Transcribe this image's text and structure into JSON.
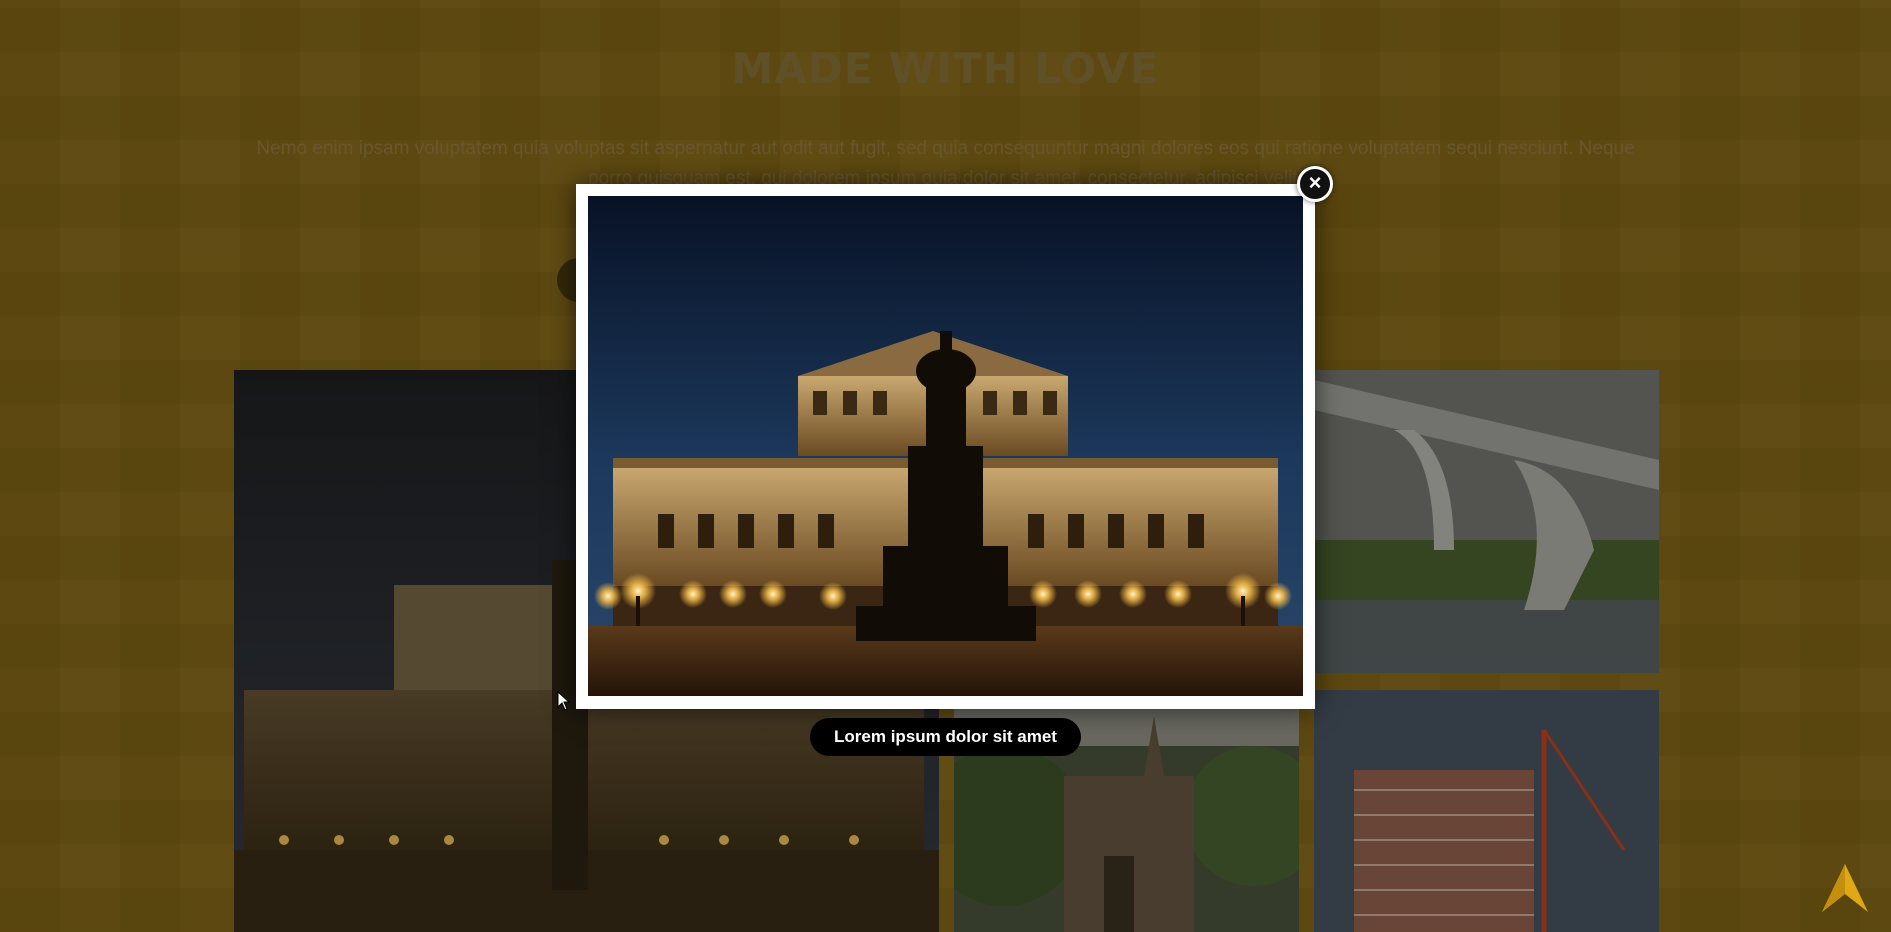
{
  "section": {
    "title": "MADE WITH LOVE",
    "text": "Nemo enim ipsam voluptatem quia voluptas sit aspernatur aut odit aut fugit, sed quia consequuntur magni dolores eos qui ratione voluptatem sequi nesciunt. Neque porro quisquam est, qui dolorem ipsum quia dolor sit amet, consectetur, adipisci velit."
  },
  "lightbox": {
    "caption": "Lorem ipsum dolor sit amet",
    "close_icon": "close-icon"
  },
  "icons": {
    "back_to_top": "arrow-up-icon"
  },
  "colors": {
    "page_background": "#7b5f12",
    "accent": "#d4a017",
    "lightbox_frame": "#ffffff"
  }
}
